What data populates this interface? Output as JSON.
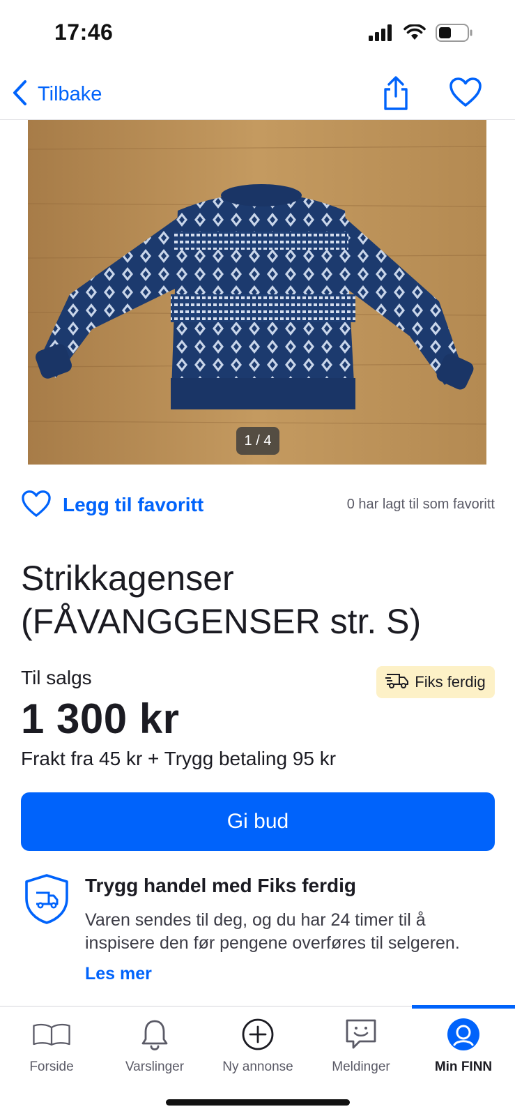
{
  "status_bar": {
    "time": "17:46",
    "icons": [
      "cellular-signal-icon",
      "wifi-icon",
      "battery-icon"
    ]
  },
  "nav": {
    "back_label": "Tilbake",
    "icons": [
      "chevron-left-icon",
      "share-icon",
      "heart-outline-icon"
    ]
  },
  "gallery": {
    "counter": "1 / 4",
    "current": 1,
    "total": 4
  },
  "favorite": {
    "label": "Legg til favoritt",
    "count_text": "0 har lagt til som favoritt"
  },
  "listing": {
    "title_line1": "Strikkagenser",
    "title_line2": "(FÅVANGGENSER str. S)",
    "sale_type": "Til salgs",
    "badge": "Fiks ferdig",
    "price": "1 300 kr",
    "shipping": "Frakt fra 45 kr + Trygg betaling 95 kr"
  },
  "bid_button": {
    "label": "Gi bud"
  },
  "safe_trade": {
    "title": "Trygg handel med Fiks ferdig",
    "text": "Varen sendes til deg, og du har 24 timer til å inspisere den før pengene overføres til selgeren.",
    "link": "Les mer"
  },
  "tabs": [
    {
      "label": "Forside",
      "icon": "book-icon"
    },
    {
      "label": "Varslinger",
      "icon": "bell-icon"
    },
    {
      "label": "Ny annonse",
      "icon": "plus-circle-icon"
    },
    {
      "label": "Meldinger",
      "icon": "chat-icon"
    },
    {
      "label": "Min FINN",
      "icon": "profile-icon",
      "active": true
    }
  ],
  "colors": {
    "accent": "#0063fb",
    "badge_bg": "#fdf1c7",
    "text": "#1b1b22",
    "muted": "#5a5a66"
  }
}
